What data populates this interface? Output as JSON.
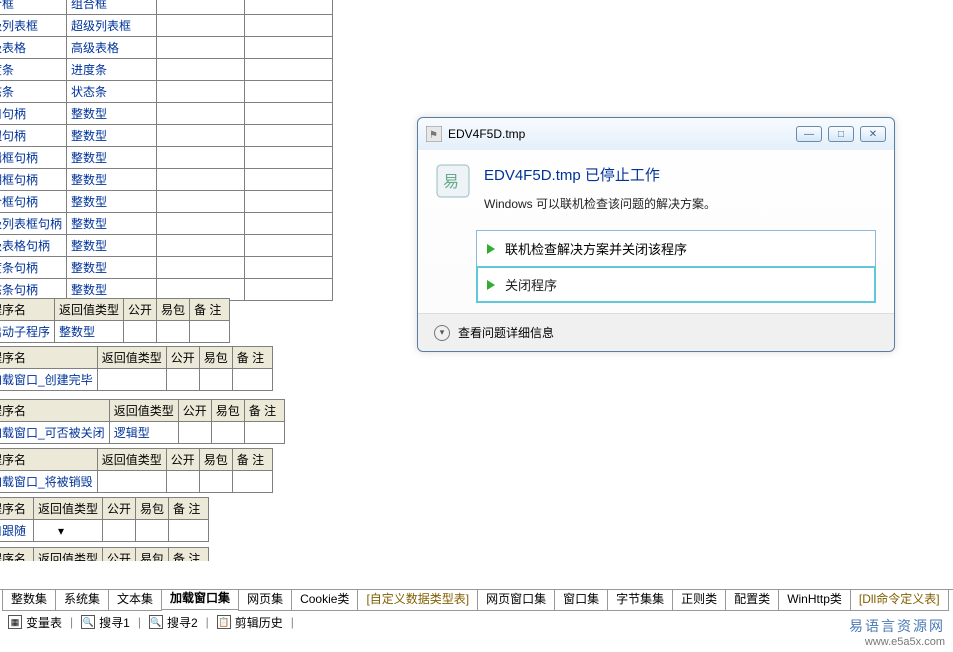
{
  "dialog": {
    "app_title": "EDV4F5D.tmp",
    "heading": "EDV4F5D.tmp 已停止工作",
    "subtext": "Windows 可以联机检查该问题的解决方案。",
    "action_online": "联机检查解决方案并关闭该程序",
    "action_close": "关闭程序",
    "details": "查看问题详细信息"
  },
  "top_table": [
    {
      "name": "合框",
      "type": "组合框"
    },
    {
      "name": "级列表框",
      "type": "超级列表框"
    },
    {
      "name": "级表格",
      "type": "高级表格"
    },
    {
      "name": "度条",
      "type": "进度条"
    },
    {
      "name": "态条",
      "type": "状态条"
    },
    {
      "name": "口句柄",
      "type": "整数型"
    },
    {
      "name": "钮句柄",
      "type": "整数型"
    },
    {
      "name": "辑框句柄",
      "type": "整数型"
    },
    {
      "name": "期框句柄",
      "type": "整数型"
    },
    {
      "name": "合框句柄",
      "type": "整数型"
    },
    {
      "name": "级列表框句柄",
      "type": "整数型"
    },
    {
      "name": "级表格句柄",
      "type": "整数型"
    },
    {
      "name": "度条句柄",
      "type": "整数型"
    },
    {
      "name": "态条句柄",
      "type": "整数型"
    }
  ],
  "header1": {
    "c0": "程序名",
    "c1": "返回值类型",
    "c2": "公开",
    "c3": "易包",
    "c4": "备 注"
  },
  "row1": {
    "c0": "启动子程序",
    "c1": "整数型"
  },
  "header2": {
    "c0": "程序名",
    "c1": "返回值类型",
    "c2": "公开",
    "c3": "易包",
    "c4": "备 注"
  },
  "row2": {
    "c0": "加载窗口_创建完毕"
  },
  "header3": {
    "c0": "程序名",
    "c1": "返回值类型",
    "c2": "公开",
    "c3": "易包",
    "c4": "备 注"
  },
  "row3": {
    "c0": "加载窗口_可否被关闭",
    "c1": "逻辑型"
  },
  "header4": {
    "c0": "程序名",
    "c1": "返回值类型",
    "c2": "公开",
    "c3": "易包",
    "c4": "备 注"
  },
  "row4": {
    "c0": "加载窗口_将被销毁"
  },
  "header5": {
    "c0": "程序名",
    "c1": "返回值类型",
    "c2": "公开",
    "c3": "易包",
    "c4": "备 注"
  },
  "row5": {
    "c0": "口跟随",
    "c1": ""
  },
  "header6": {
    "c0": "程序名",
    "c1": "返回值类型",
    "c2": "公开",
    "c3": "易包",
    "c4": "备 注"
  },
  "tabs": [
    "整数集",
    "系统集",
    "文本集",
    "加载窗口集",
    "网页集",
    "Cookie类",
    "[自定义数据类型表]",
    "网页窗口集",
    "窗口集",
    "字节集集",
    "正则类",
    "配置类",
    "WinHttp类",
    "[Dll命令定义表]"
  ],
  "toolbar": {
    "a": "变量表",
    "b": "搜寻1",
    "c": "搜寻2",
    "d": "剪辑历史"
  },
  "watermark": {
    "zh": "易语言资源网",
    "en": "www.e5a5x.com"
  }
}
